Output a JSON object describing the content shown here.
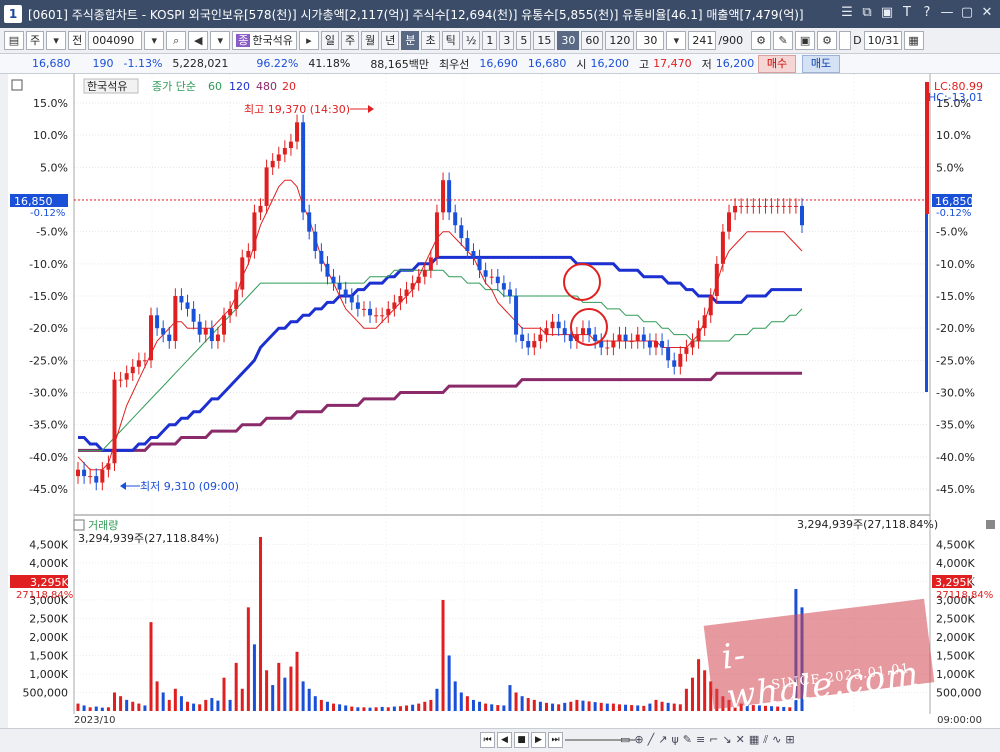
{
  "titlebar": {
    "title": "[0601] 주식종합차트 - KOSPI 외국인보유[578(천)] 시가총액[2,117(억)] 주식수[12,694(천)] 유통수[5,855(천)] 유통비율[46.1] 매출액[7,479(억)]",
    "window_num": "1",
    "buttons": [
      "☰",
      "⧉",
      "▣",
      "T",
      "?",
      "—",
      "▢",
      "✕"
    ]
  },
  "toolbar": {
    "period_type": "주",
    "market": "전",
    "code": "004090",
    "stock_name": "한국석유",
    "periods": [
      "일",
      "주",
      "월",
      "년",
      "분",
      "초",
      "틱"
    ],
    "selected_period": "분",
    "half": "½",
    "minutes": [
      "1",
      "3",
      "5",
      "15",
      "30",
      "60",
      "120"
    ],
    "selected_minute": "30",
    "minute_box": "30",
    "count": "241",
    "total": "/900",
    "date": "10/31",
    "d_label": "D"
  },
  "quote": {
    "price": "16,680",
    "change": "190",
    "change_pct": "-1.13%",
    "volume": "5,228,021",
    "vol_ratio": "96.22%",
    "turnover": "41.18%",
    "amount": "88,165백만",
    "best_ask_label": "최우선",
    "best_ask": "16,690",
    "best_bid": "16,680",
    "open_label": "시",
    "open": "16,200",
    "high_label": "고",
    "high": "17,470",
    "low_label": "저",
    "low": "16,200",
    "buy": "매수",
    "sell": "매도"
  },
  "legend": {
    "name": "한국석유",
    "ma_label": "종가 단순",
    "ma": [
      "60",
      "120",
      "480",
      "20"
    ],
    "ma_colors": [
      "#2f9a57",
      "#1c2fd0",
      "#8a2a6a",
      "#e02020"
    ]
  },
  "price_panel": {
    "lc": "LC:80.99",
    "hc": "HC:-13.01",
    "current_tag": "16,850",
    "current_pct": "-0.12%",
    "annot_high": "최고 19,370 (14:30)",
    "annot_low": "최저 9,310 (09:00)",
    "y_ticks": [
      "15.0%",
      "10.0%",
      "5.0%",
      "0.0%",
      "-5.0%",
      "-10.0%",
      "-15.0%",
      "-20.0%",
      "-25.0%",
      "-30.0%",
      "-35.0%",
      "-40.0%",
      "-45.0%"
    ]
  },
  "volume_panel": {
    "label": "거래량",
    "summary": "3,294,939주(27,118.84%)",
    "tag": "3,295K",
    "tag_pct": "27118.84%",
    "y_ticks": [
      "4,500K",
      "4,000K",
      "3,500K",
      "3,000K",
      "2,500K",
      "2,000K",
      "1,500K",
      "1,000K",
      "500,000"
    ],
    "y_ticks_right": [
      "4,500K",
      "4,000K",
      "3,500K",
      "3,000K",
      "2,500K",
      "2,000K",
      "1,500K",
      "1,000K",
      "500,000"
    ]
  },
  "axis": {
    "start_date": "2023/10",
    "time": "09:00:00"
  },
  "watermark": {
    "brand": "i-whale.com",
    "since": "SINCE 2023.01.01"
  },
  "colors": {
    "up": "#e02020",
    "down": "#1a4fd8",
    "ma60": "#2f9a57",
    "ma120": "#1c2fd0",
    "ma480": "#8a2a6a",
    "ma20": "#e02020"
  },
  "chart_data": {
    "type": "candlestick",
    "x_label": "",
    "y_label": "",
    "ylim_pct": [
      -47,
      17
    ],
    "candles_count": 120,
    "close_path": [
      -42,
      -43,
      -43,
      -44,
      -42,
      -41,
      -28,
      -28,
      -27,
      -26,
      -25,
      -25,
      -18,
      -20,
      -21,
      -22,
      -15,
      -16,
      -17,
      -19,
      -21,
      -20,
      -22,
      -21,
      -18,
      -17,
      -14,
      -9,
      -8,
      -2,
      -1,
      5,
      6,
      7,
      8,
      9,
      12,
      -2,
      -5,
      -8,
      -10,
      -12,
      -13,
      -14,
      -15,
      -16,
      -17,
      -17,
      -18,
      -18,
      -18,
      -17,
      -16,
      -15,
      -14,
      -13,
      -12,
      -11,
      -9,
      -2,
      3,
      -2,
      -4,
      -6,
      -8,
      -9,
      -11,
      -12,
      -12,
      -13,
      -14,
      -15,
      -21,
      -22,
      -23,
      -22,
      -21,
      -20,
      -19,
      -20,
      -21,
      -22,
      -21,
      -20,
      -21,
      -22,
      -23,
      -23,
      -22,
      -21,
      -22,
      -22,
      -21,
      -22,
      -23,
      -22,
      -23,
      -25,
      -26,
      -24,
      -23,
      -22,
      -20,
      -18,
      -15,
      -10,
      -5,
      -2,
      -1,
      -1,
      -1,
      -1,
      -1,
      -1,
      -1,
      -1,
      -1,
      -1,
      -1,
      -4
    ],
    "ma20": [
      -40,
      -41,
      -42,
      -42,
      -42,
      -41,
      -38,
      -35,
      -32,
      -30,
      -28,
      -26,
      -24,
      -22,
      -21,
      -20,
      -19,
      -19,
      -20,
      -20,
      -20,
      -20,
      -20,
      -19,
      -18,
      -17,
      -15,
      -12,
      -10,
      -7,
      -4,
      -2,
      0,
      2,
      3,
      3,
      2,
      -1,
      -3,
      -6,
      -9,
      -11,
      -13,
      -15,
      -17,
      -18,
      -19,
      -20,
      -20,
      -20,
      -19,
      -18,
      -17,
      -16,
      -15,
      -14,
      -12,
      -10,
      -8,
      -6,
      -5,
      -5,
      -6,
      -7,
      -8,
      -9,
      -11,
      -13,
      -14,
      -16,
      -17,
      -18,
      -19,
      -20,
      -20,
      -20,
      -20,
      -21,
      -21,
      -21,
      -21,
      -21,
      -21,
      -21,
      -21,
      -22,
      -22,
      -22,
      -22,
      -22,
      -22,
      -22,
      -22,
      -22,
      -22,
      -22,
      -23,
      -23,
      -23,
      -23,
      -23,
      -22,
      -21,
      -19,
      -16,
      -13,
      -10,
      -8,
      -7,
      -6,
      -5,
      -5,
      -5,
      -5,
      -5,
      -5,
      -5,
      -6,
      -7,
      -8
    ],
    "ma60": [
      -39,
      -39,
      -39,
      -39,
      -39,
      -38,
      -37,
      -36,
      -35,
      -34,
      -33,
      -32,
      -31,
      -30,
      -29,
      -28,
      -27,
      -26,
      -25,
      -24,
      -23,
      -22,
      -21,
      -20,
      -19,
      -18,
      -17,
      -16,
      -15,
      -14,
      -13,
      -13,
      -13,
      -13,
      -13,
      -13,
      -13,
      -13,
      -13,
      -13,
      -13,
      -13,
      -13,
      -13,
      -13,
      -13,
      -13,
      -13,
      -12,
      -12,
      -12,
      -12,
      -11,
      -11,
      -11,
      -11,
      -11,
      -11,
      -11,
      -11,
      -11,
      -12,
      -12,
      -12,
      -13,
      -13,
      -13,
      -14,
      -14,
      -14,
      -15,
      -15,
      -15,
      -15,
      -15,
      -15,
      -15,
      -15,
      -15,
      -15,
      -15,
      -15,
      -15,
      -16,
      -16,
      -16,
      -16,
      -17,
      -17,
      -17,
      -18,
      -18,
      -18,
      -19,
      -19,
      -19,
      -20,
      -20,
      -21,
      -21,
      -21,
      -22,
      -22,
      -22,
      -22,
      -22,
      -22,
      -22,
      -21,
      -21,
      -21,
      -20,
      -20,
      -20,
      -19,
      -19,
      -19,
      -18,
      -18,
      -17
    ],
    "ma120": [
      -37,
      -37,
      -38,
      -38,
      -39,
      -39,
      -39,
      -39,
      -39,
      -39,
      -38,
      -38,
      -37,
      -37,
      -36,
      -35,
      -35,
      -34,
      -34,
      -33,
      -33,
      -32,
      -31,
      -31,
      -30,
      -29,
      -28,
      -27,
      -26,
      -25,
      -23,
      -22,
      -21,
      -20,
      -20,
      -19,
      -19,
      -18,
      -18,
      -17,
      -17,
      -16,
      -16,
      -15,
      -15,
      -15,
      -14,
      -14,
      -13,
      -13,
      -13,
      -12,
      -12,
      -11,
      -11,
      -11,
      -10,
      -10,
      -10,
      -9,
      -9,
      -9,
      -9,
      -9,
      -9,
      -9,
      -9,
      -9,
      -9,
      -9,
      -9,
      -9,
      -9,
      -9,
      -9,
      -9,
      -9,
      -9,
      -9,
      -9,
      -9,
      -9,
      -10,
      -10,
      -10,
      -10,
      -10,
      -10,
      -10,
      -11,
      -11,
      -11,
      -11,
      -12,
      -12,
      -12,
      -12,
      -13,
      -13,
      -13,
      -14,
      -14,
      -15,
      -15,
      -15,
      -16,
      -16,
      -16,
      -16,
      -16,
      -15,
      -15,
      -15,
      -15,
      -14,
      -14,
      -14,
      -14,
      -14,
      -14
    ],
    "ma480": [
      -39,
      -39,
      -39,
      -39,
      -39,
      -39,
      -39,
      -39,
      -39,
      -39,
      -39,
      -39,
      -38,
      -38,
      -38,
      -38,
      -38,
      -37,
      -37,
      -37,
      -37,
      -37,
      -36,
      -36,
      -36,
      -36,
      -36,
      -35,
      -35,
      -35,
      -35,
      -34,
      -34,
      -34,
      -34,
      -34,
      -33,
      -33,
      -33,
      -33,
      -33,
      -32,
      -32,
      -32,
      -32,
      -32,
      -32,
      -31,
      -31,
      -31,
      -31,
      -31,
      -31,
      -30,
      -30,
      -30,
      -30,
      -30,
      -30,
      -30,
      -30,
      -29,
      -29,
      -29,
      -29,
      -29,
      -29,
      -29,
      -29,
      -29,
      -29,
      -29,
      -29,
      -28,
      -28,
      -28,
      -28,
      -28,
      -28,
      -28,
      -28,
      -28,
      -28,
      -28,
      -28,
      -28,
      -28,
      -28,
      -28,
      -28,
      -28,
      -28,
      -28,
      -28,
      -28,
      -28,
      -28,
      -28,
      -28,
      -28,
      -28,
      -28,
      -28,
      -28,
      -28,
      -27,
      -27,
      -27,
      -27,
      -27,
      -27,
      -27,
      -27,
      -27,
      -27,
      -27,
      -27,
      -27,
      -27,
      -27
    ],
    "volume_k": [
      200,
      150,
      100,
      120,
      90,
      100,
      500,
      400,
      300,
      250,
      200,
      150,
      2400,
      800,
      500,
      300,
      600,
      400,
      250,
      200,
      180,
      300,
      350,
      280,
      900,
      300,
      1300,
      600,
      2800,
      1800,
      4700,
      1100,
      700,
      1300,
      900,
      1200,
      1600,
      800,
      600,
      400,
      300,
      250,
      200,
      180,
      150,
      120,
      100,
      100,
      90,
      100,
      110,
      100,
      120,
      130,
      150,
      170,
      200,
      250,
      300,
      600,
      3000,
      1500,
      800,
      500,
      400,
      300,
      250,
      200,
      180,
      160,
      150,
      700,
      500,
      400,
      350,
      300,
      250,
      220,
      200,
      180,
      220,
      250,
      300,
      280,
      260,
      240,
      220,
      200,
      200,
      180,
      170,
      160,
      150,
      140,
      200,
      300,
      250,
      220,
      200,
      180,
      600,
      900,
      1400,
      1100,
      800,
      600,
      400,
      300,
      250,
      200,
      180,
      160,
      150,
      140,
      130,
      120,
      110,
      100,
      3295,
      2800
    ],
    "volume_up": [
      1,
      0,
      1,
      0,
      0,
      1,
      1,
      1,
      0,
      1,
      1,
      0,
      1,
      1,
      0,
      1,
      1,
      0,
      1,
      0,
      1,
      1,
      0,
      0,
      1,
      0,
      1,
      1,
      1,
      0,
      1,
      1,
      0,
      1,
      0,
      1,
      1,
      0,
      0,
      0,
      1,
      0,
      1,
      0,
      0,
      1,
      0,
      1,
      0,
      1,
      0,
      1,
      0,
      1,
      1,
      0,
      1,
      1,
      1,
      0,
      1,
      0,
      0,
      0,
      1,
      0,
      0,
      1,
      0,
      1,
      0,
      0,
      1,
      0,
      1,
      1,
      0,
      1,
      0,
      1,
      0,
      1,
      1,
      0,
      1,
      0,
      1,
      0,
      1,
      1,
      0,
      1,
      0,
      1,
      0,
      1,
      1,
      0,
      1,
      1,
      1,
      1,
      1,
      1,
      1,
      1,
      1,
      1,
      1,
      1,
      0,
      1,
      0,
      1,
      0,
      1,
      0,
      1,
      0,
      0
    ]
  }
}
